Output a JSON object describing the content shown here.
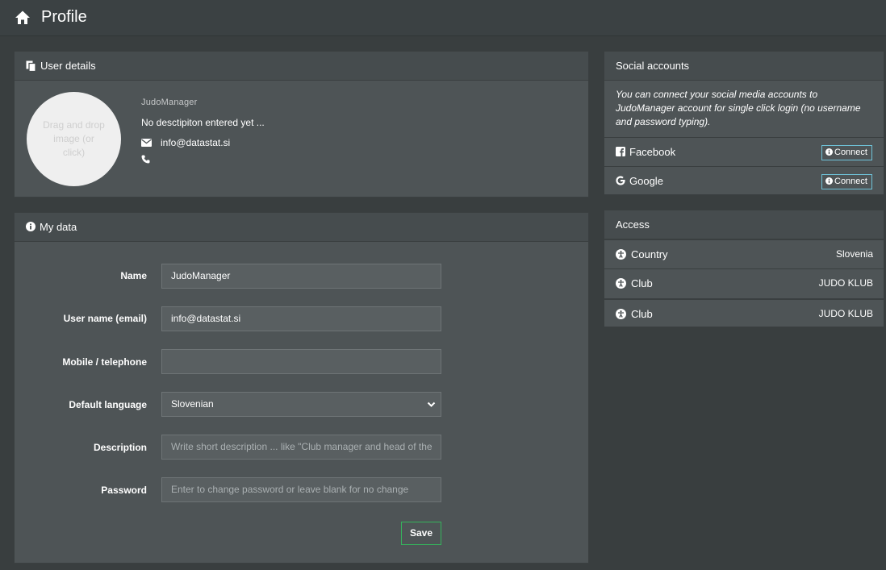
{
  "header": {
    "title": "Profile",
    "icon": "home-icon"
  },
  "user_details": {
    "title": "User details",
    "avatar_hint": "Drag and drop image (or click)",
    "name": "JudoManager",
    "description": "No desctipiton entered yet ...",
    "email": "info@datastat.si"
  },
  "my_data": {
    "title": "My data",
    "fields": {
      "name": {
        "label": "Name",
        "value": "JudoManager"
      },
      "username": {
        "label": "User name (email)",
        "value": "info@datastat.si"
      },
      "phone": {
        "label": "Mobile / telephone",
        "value": ""
      },
      "language": {
        "label": "Default language",
        "value": "Slovenian"
      },
      "description": {
        "label": "Description",
        "placeholder": "Write short description ... like \"Club manager and head of the"
      },
      "password": {
        "label": "Password",
        "placeholder": "Enter to change password or leave blank for no change"
      }
    },
    "save_label": "Save"
  },
  "social": {
    "title": "Social accounts",
    "note": "You can connect your social media accounts to JudoManager account for single click login (no username and password typing).",
    "accounts": [
      {
        "name": "Facebook",
        "icon": "facebook-icon",
        "button": "Connect"
      },
      {
        "name": "Google",
        "icon": "google-icon",
        "button": "Connect"
      }
    ]
  },
  "access": {
    "title": "Access",
    "rows": [
      {
        "label": "Country",
        "value": "Slovenia"
      },
      {
        "label": "Club",
        "value": "JUDO KLUB"
      },
      {
        "label": "Club",
        "value": "JUDO KLUB"
      }
    ]
  },
  "colors": {
    "background": "#393e3f",
    "panel": "#4e5456",
    "panel_header": "#464c4e",
    "save_border": "#35b35c",
    "connect_border": "#6fc3d9"
  }
}
